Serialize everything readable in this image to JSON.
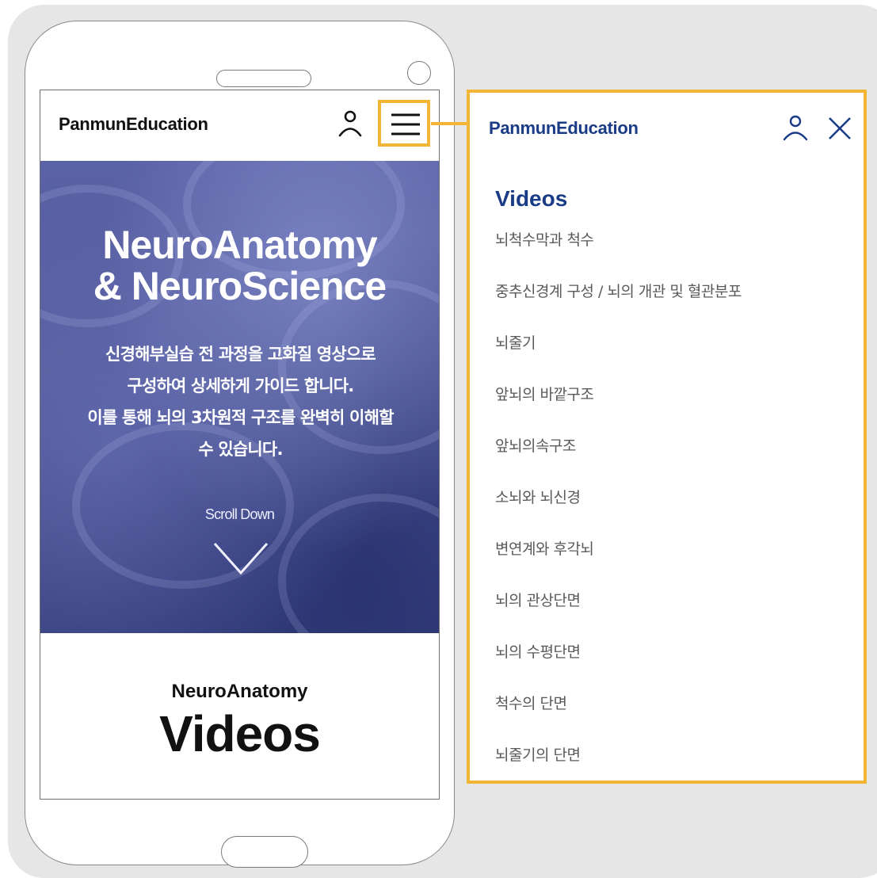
{
  "app": {
    "brand": "PanmunEducation"
  },
  "hero": {
    "title_line1": "NeuroAnatomy",
    "title_line2": "& NeuroScience",
    "desc_line1": "신경해부실습 전 과정을 고화질 영상으로",
    "desc_line2": "구성하여 상세하게 가이드 합니다.",
    "desc_line3": "이를 통해 뇌의 3차원적 구조를 완벽히 이해할",
    "desc_line4": "수 있습니다.",
    "scroll_label": "Scroll Down"
  },
  "section": {
    "subtitle": "NeuroAnatomy",
    "title": "Videos"
  },
  "drawer": {
    "brand": "PanmunEducation",
    "section_title": "Videos",
    "items": [
      {
        "label": "뇌척수막과 척수"
      },
      {
        "label": "중추신경계 구성 / 뇌의 개관 및 혈관분포"
      },
      {
        "label": "뇌줄기"
      },
      {
        "label": "앞뇌의 바깥구조"
      },
      {
        "label": "앞뇌의속구조"
      },
      {
        "label": "소뇌와 뇌신경"
      },
      {
        "label": "변연계와 후각뇌"
      },
      {
        "label": "뇌의 관상단면"
      },
      {
        "label": "뇌의 수평단면"
      },
      {
        "label": "척수의 단면"
      },
      {
        "label": "뇌줄기의 단면"
      }
    ]
  },
  "icons": {
    "user": "user-icon",
    "menu": "hamburger-menu-icon",
    "close": "close-icon",
    "scroll": "chevron-down-icon"
  },
  "colors": {
    "highlight": "#f2b535",
    "brand_blue": "#1a3b85",
    "hero_bg": "#545b9c"
  }
}
